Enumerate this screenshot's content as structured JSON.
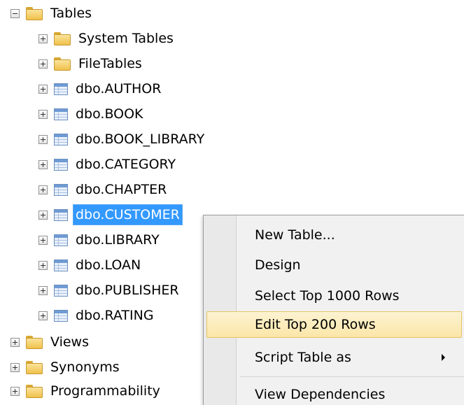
{
  "tree": {
    "tables_label": "Tables",
    "system_tables_label": "System Tables",
    "filetables_label": "FileTables",
    "table_items": [
      "dbo.AUTHOR",
      "dbo.BOOK",
      "dbo.BOOK_LIBRARY",
      "dbo.CATEGORY",
      "dbo.CHAPTER",
      "dbo.CUSTOMER",
      "dbo.LIBRARY",
      "dbo.LOAN",
      "dbo.PUBLISHER",
      "dbo.RATING"
    ],
    "selected_item": "dbo.CUSTOMER",
    "views_label": "Views",
    "synonyms_label": "Synonyms",
    "programmability_label": "Programmability"
  },
  "context_menu": {
    "items": [
      "New Table...",
      "Design",
      "Select Top 1000 Rows",
      "Edit Top 200 Rows",
      "Script Table as",
      "View Dependencies"
    ],
    "hovered_item": "Edit Top 200 Rows"
  },
  "colors": {
    "selection": "#3399ff",
    "menu_hover": "#fbe6a8",
    "folder": "#f0c14c",
    "table_icon": "#6f9bd4"
  },
  "icons": {
    "folder": "folder-icon",
    "table": "table-icon",
    "expand": "expand-icon",
    "collapse": "collapse-icon",
    "submenu": "submenu-arrow-icon"
  }
}
